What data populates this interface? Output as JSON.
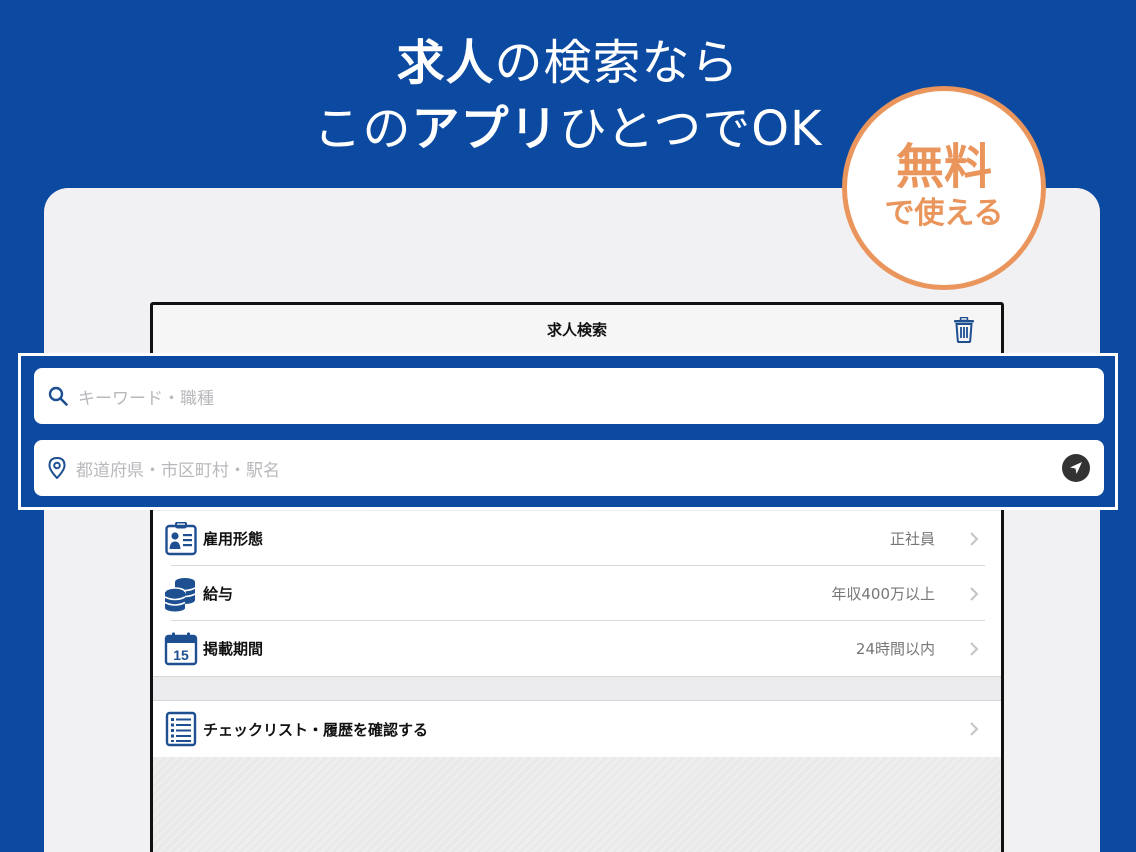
{
  "headline": {
    "line1_bold": "求人",
    "line1_rest": "の検索なら",
    "line2_start": "この",
    "line2_bold": "アプリ",
    "line2_end": "ひとつでOK"
  },
  "badge": {
    "line1": "無料",
    "line2": "で使える",
    "color": "#e9955c"
  },
  "navbar": {
    "title": "求人検索",
    "trash_icon": "trash-icon"
  },
  "search": {
    "keyword_placeholder": "キーワード・職種",
    "location_placeholder": "都道府県・市区町村・駅名",
    "search_icon": "search-icon",
    "pin_icon": "location-pin-icon",
    "locate_icon": "navigation-arrow-icon"
  },
  "filters": [
    {
      "label": "雇用形態",
      "value": "正社員",
      "icon": "id-card-icon"
    },
    {
      "label": "給与",
      "value": "年収400万以上",
      "icon": "coins-icon"
    },
    {
      "label": "掲載期間",
      "value": "24時間以内",
      "icon": "calendar-icon",
      "calendar_day": "15"
    }
  ],
  "checklist": {
    "label": "チェックリスト・履歴を確認する",
    "icon": "list-icon"
  },
  "colors": {
    "brand_blue": "#0b4aa0",
    "icon_blue": "#1d4f91",
    "accent_orange": "#e9955c"
  }
}
